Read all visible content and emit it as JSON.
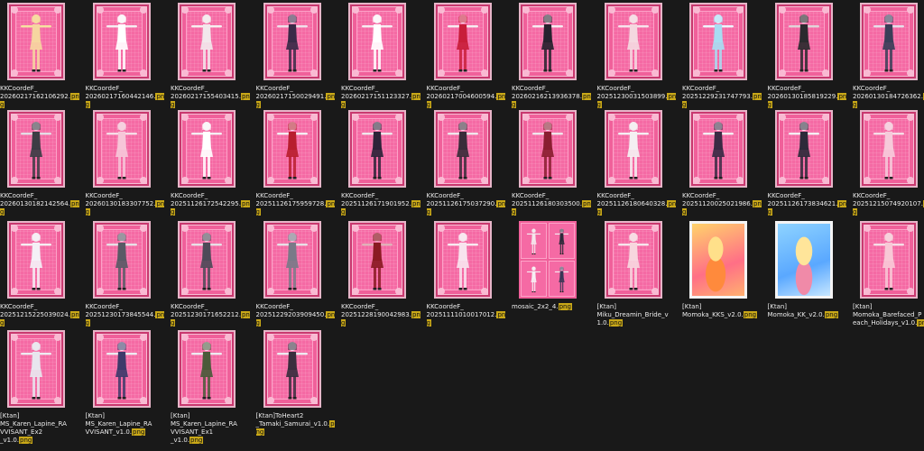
{
  "files": [
    {
      "line1": "KKCoordeF_",
      "line2": "20260217162106292.",
      "ext": "png",
      "kind": "figure",
      "skin": "#f6e2a0",
      "outfit": "#f6d6a0"
    },
    {
      "line1": "KKCoordeF_",
      "line2": "20260217160442146.",
      "ext": "png",
      "kind": "figure",
      "skin": "#f5eef2",
      "outfit": "#ffffff"
    },
    {
      "line1": "KKCoordeF_",
      "line2": "20260217155403415.",
      "ext": "png",
      "kind": "figure",
      "skin": "#f6f0f0",
      "outfit": "#f2e8ec"
    },
    {
      "line1": "KKCoordeF_",
      "line2": "20260217150029491.",
      "ext": "png",
      "kind": "figure",
      "skin": "#f0e0ea",
      "outfit": "#3a2a48"
    },
    {
      "line1": "KKCoordeF_",
      "line2": "20260217151123327.",
      "ext": "png",
      "kind": "figure",
      "skin": "#f6eef2",
      "outfit": "#ffffff"
    },
    {
      "line1": "KKCoordeF_",
      "line2": "20260217004600594.",
      "ext": "png",
      "kind": "figure",
      "skin": "#f6eef2",
      "outfit": "#c81e3a"
    },
    {
      "line1": "KKCoordeF_",
      "line2": "20260216213936378.",
      "ext": "png",
      "kind": "figure",
      "skin": "#f6eef2",
      "outfit": "#26222e"
    },
    {
      "line1": "KKCoordeF_",
      "line2": "20251230031503899.",
      "ext": "png",
      "kind": "figure",
      "skin": "#f6e4ec",
      "outfit": "#f4d8e0"
    },
    {
      "line1": "KKCoordeF_",
      "line2": "20251229231747793.",
      "ext": "png",
      "kind": "figure",
      "skin": "#eef6ff",
      "outfit": "#a8dcf2"
    },
    {
      "line1": "KKCoordeF_",
      "line2": "20260130185819229.",
      "ext": "png",
      "kind": "figure",
      "skin": "#e0d4d8",
      "outfit": "#2a2a2e"
    },
    {
      "line1": "KKCoordeF_",
      "line2": "20260130184726362.",
      "ext": "png",
      "kind": "figure",
      "skin": "#e6e0ea",
      "outfit": "#3a3e58"
    },
    {
      "line1": "KKCoordeF_",
      "line2": "20260130182142564.",
      "ext": "png",
      "kind": "figure",
      "skin": "#e4dce4",
      "outfit": "#3c3c44"
    },
    {
      "line1": "KKCoordeF_",
      "line2": "20260130183307752.",
      "ext": "png",
      "kind": "figure",
      "skin": "#f6dce6",
      "outfit": "#f6c6d8"
    },
    {
      "line1": "KKCoordeF_",
      "line2": "20251126172542295.",
      "ext": "png",
      "kind": "figure",
      "skin": "#f4eef2",
      "outfit": "#ffffff"
    },
    {
      "line1": "KKCoordeF_",
      "line2": "20251126175959728.",
      "ext": "png",
      "kind": "figure",
      "skin": "#f4eef2",
      "outfit": "#b81e2e"
    },
    {
      "line1": "KKCoordeF_",
      "line2": "20251126171901952.",
      "ext": "png",
      "kind": "figure",
      "skin": "#f0e6ec",
      "outfit": "#2c2338"
    },
    {
      "line1": "KKCoordeF_",
      "line2": "20251126175037290.",
      "ext": "png",
      "kind": "figure",
      "skin": "#f0e6ec",
      "outfit": "#3a2c3a"
    },
    {
      "line1": "KKCoordeF_",
      "line2": "20251126180303500.",
      "ext": "png",
      "kind": "figure",
      "skin": "#f0e6ec",
      "outfit": "#8a1e30"
    },
    {
      "line1": "KKCoordeF_",
      "line2": "20251126180640328.",
      "ext": "png",
      "kind": "figure",
      "skin": "#f4eef2",
      "outfit": "#f4f0f2"
    },
    {
      "line1": "KKCoordeF_",
      "line2": "20251120025021986.",
      "ext": "png",
      "kind": "figure",
      "skin": "#f4eef2",
      "outfit": "#3a2a44"
    },
    {
      "line1": "KKCoordeF_",
      "line2": "20251126173834621.",
      "ext": "png",
      "kind": "figure",
      "skin": "#f4eef2",
      "outfit": "#2e2a3a"
    },
    {
      "line1": "KKCoordeF_",
      "line2": "20251215074920107.",
      "ext": "png",
      "kind": "figure",
      "skin": "#f6dce6",
      "outfit": "#f6cada"
    },
    {
      "line1": "KKCoordeF_",
      "line2": "20251215225039024.",
      "ext": "png",
      "kind": "figure",
      "skin": "#f6eef2",
      "outfit": "#f4f0f6"
    },
    {
      "line1": "KKCoordeF_",
      "line2": "20251230173845544.",
      "ext": "png",
      "kind": "figure",
      "skin": "#e8e0e6",
      "outfit": "#5a5a66"
    },
    {
      "line1": "KKCoordeF_",
      "line2": "20251230171652212.",
      "ext": "png",
      "kind": "figure",
      "skin": "#e8e0e6",
      "outfit": "#4e4a58"
    },
    {
      "line1": "KKCoordeF_",
      "line2": "20251229203909450.",
      "ext": "png",
      "kind": "figure",
      "skin": "#e8e0e6",
      "outfit": "#7a7a88"
    },
    {
      "line1": "KKCoordeF_",
      "line2": "20251228190042983.",
      "ext": "png",
      "kind": "figure",
      "skin": "#e0b0b8",
      "outfit": "#8a1a22"
    },
    {
      "line1": "KKCoordeF_",
      "line2": "20251111010017012.",
      "ext": "png",
      "kind": "figure",
      "skin": "#f8eaf0",
      "outfit": "#f8e4ee"
    },
    {
      "line1": "mosaic_2x2_4.",
      "line2": "",
      "ext": "png",
      "kind": "mosaic",
      "skin": "#f4e6ec",
      "outfit": "#e8d0dc"
    },
    {
      "line1": "[Ktan]",
      "line2": "Miku_Dreamin_Bride_v",
      "line3": "1.0.",
      "ext": "png",
      "kind": "figure",
      "skin": "#f6e6ec",
      "outfit": "#f7d6de"
    },
    {
      "line1": "[Ktan]",
      "line2": "Momoka_KKS_v2.0.",
      "ext": "png",
      "kind": "photo1"
    },
    {
      "line1": "[Ktan]",
      "line2": "Momoka_KK_v2.0.",
      "ext": "png",
      "kind": "photo2"
    },
    {
      "line1": "[Ktan]",
      "line2": "Momoka_Barefaced_P",
      "line3": "each_Holidays_v1.0.",
      "ext": "png",
      "kind": "figure",
      "skin": "#f6dde6",
      "outfit": "#f8c8d6"
    },
    {
      "line1": "[Ktan]",
      "line2": "MS_Karen_Lapine_RA",
      "line3": "VVISANT_Ex2",
      "line4": "_v1.0.",
      "ext": "png",
      "kind": "figure",
      "skin": "#eeeaf0",
      "outfit": "#e8e6ee"
    },
    {
      "line1": "[Ktan]",
      "line2": "MS_Karen_Lapine_RA",
      "line3": "VVISANT_v1.0.",
      "ext": "png",
      "kind": "figure",
      "skin": "#eeeaf0",
      "outfit": "#3e3a6a"
    },
    {
      "line1": "[Ktan]",
      "line2": "MS_Karen_Lapine_RA",
      "line3": "VVISANT_Ex1",
      "line4": "_v1.0.",
      "ext": "png",
      "kind": "figure",
      "skin": "#eeeaf0",
      "outfit": "#4a5a3a"
    },
    {
      "line1": "[Ktan]ToHeart2",
      "line2": "_Tamaki_Samurai_v1.0.",
      "ext": "png",
      "kind": "figure",
      "skin": "#eeeaf0",
      "outfit": "#3a2e3e"
    }
  ]
}
